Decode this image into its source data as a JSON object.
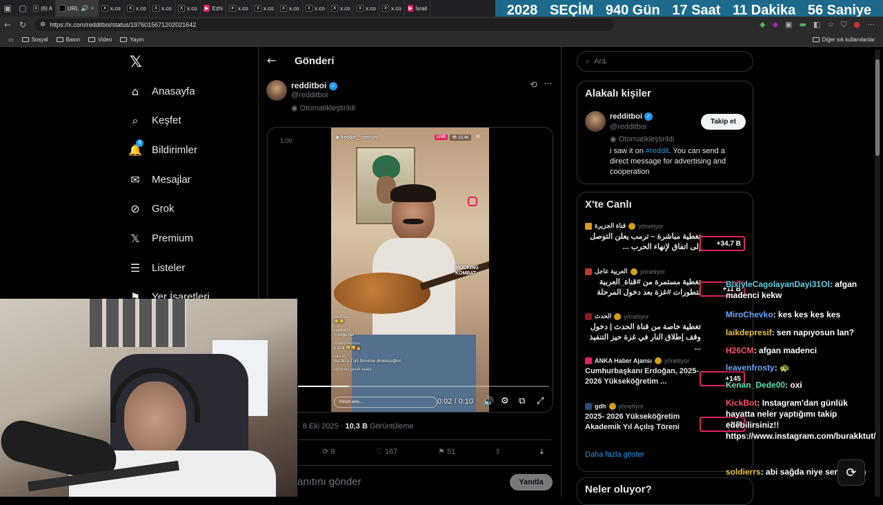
{
  "browser": {
    "tabs": [
      {
        "icon": "X",
        "label": "(6) A",
        "style": "x"
      },
      {
        "icon": "",
        "label": "URL",
        "style": "active"
      },
      {
        "icon": "X",
        "label": "x.co",
        "style": "x"
      },
      {
        "icon": "X",
        "label": "x.co",
        "style": "x"
      },
      {
        "icon": "X",
        "label": "x.co",
        "style": "x"
      },
      {
        "icon": "X",
        "label": "x.co",
        "style": "x"
      },
      {
        "icon": "▶",
        "label": "Ezhi",
        "style": "yt"
      },
      {
        "icon": "X",
        "label": "x.co",
        "style": "x"
      },
      {
        "icon": "X",
        "label": "x.co",
        "style": "x"
      },
      {
        "icon": "X",
        "label": "x.co",
        "style": "x"
      },
      {
        "icon": "X",
        "label": "x.co",
        "style": "x"
      },
      {
        "icon": "X",
        "label": "x.co",
        "style": "x"
      },
      {
        "icon": "X",
        "label": "x.co",
        "style": "x"
      },
      {
        "icon": "X",
        "label": "x.co",
        "style": "x"
      },
      {
        "icon": "▶",
        "label": "İsrail",
        "style": "yt"
      }
    ],
    "url": "https://x.com/redditboi/status/1976015671202021642",
    "bookmarks": [
      "Sosyal",
      "Basın",
      "Video",
      "Yayın"
    ],
    "other_bookmarks": "Diğer sık kullanılanlar"
  },
  "countdown": {
    "year": "2028",
    "label": "SEÇİM",
    "days": "940 Gün",
    "hours": "17 Saat",
    "minutes": "11 Dakika",
    "seconds": "56 Saniye"
  },
  "sidebar": {
    "items": [
      {
        "icon": "home-icon",
        "label": "Anasayfa"
      },
      {
        "icon": "search-icon",
        "label": "Keşfet"
      },
      {
        "icon": "bell-icon",
        "label": "Bildirimler"
      },
      {
        "icon": "mail-icon",
        "label": "Mesajlar"
      },
      {
        "icon": "grok-icon",
        "label": "Grok"
      },
      {
        "icon": "x-icon",
        "label": "Premium"
      },
      {
        "icon": "list-icon",
        "label": "Listeler"
      },
      {
        "icon": "bookmark-icon",
        "label": "Yer İşaretleri"
      }
    ],
    "notif_badge": "9"
  },
  "post": {
    "header_title": "Gönderi",
    "name": "redditboi",
    "handle": "@redditboi",
    "automated": "Otomatikleştirildi",
    "playback_speed": "1.00",
    "video": {
      "stream_user": "freddie__mercury",
      "live_badge": "LIVE",
      "viewers": "23,4K",
      "time": "0:02 / 0:10",
      "progress": 0.2,
      "watermark": "MOCKING KOMBAT",
      "comments": [
        {
          "user": "bkdf.coel",
          "text": "😂😂"
        },
        {
          "user": "jaodiano_",
          "text": "Yüreğe hel"
        },
        {
          "user": "tinanqmenusu",
          "text": "p bi ik 😂😂🔥"
        },
        {
          "user": "sau.si_",
          "text": "But $0 b Türü Bimeme dinleteceğim!"
        },
        {
          "user": "sdhmnis gerek waka",
          "text": ""
        }
      ],
      "comment_placeholder": "Yorum ekle..."
    },
    "date": "8 Eki 2025",
    "views_count": "10,3 B",
    "views_label": "Görüntüleme",
    "replies": "",
    "reposts": "9",
    "likes": "167",
    "bookmarks": "51",
    "reply_placeholder": "anıtını gönder",
    "reply_button": "Yanıtla"
  },
  "right": {
    "search_placeholder": "Ara",
    "related_title": "Alakalı kişiler",
    "related_user": {
      "name": "redditboi",
      "handle": "@redditboi",
      "automated": "Otomatikleştirildi",
      "follow": "Takip et",
      "bio_pre": "i saw it on ",
      "bio_tag": "#reddit",
      "bio_post": ". You can send a direct message for advertising and cooperation"
    },
    "live_title": "X'te Canlı",
    "live_items": [
      {
        "source": "قناة الجزيرة",
        "status": "yönetiyor",
        "title": "تغطية مباشرة – ترمب يعلن التوصل إلى اتفاق لإنهاء الحرب ...",
        "count": "+34,7 B",
        "rtl": true
      },
      {
        "source": "العربية عاجل",
        "status": "yönetiyor",
        "title": "تغطية مستمرة من #قناة_العربية لتطورات #غزة بعد دخول المرحلة",
        "count": "+11 B",
        "rtl": true
      },
      {
        "source": "الحدث",
        "status": "yönetiyor",
        "title": "تغطية خاصة من قناة الحدث | دخول وقف إطلاق النار في غزة حيز التنفيذ ...",
        "count": "",
        "rtl": true
      },
      {
        "source": "ANKA Haber Ajansı",
        "status": "yönetiyor",
        "title": "Cumhurbaşkanı Erdoğan, 2025-2026 Yükseköğretim ...",
        "count": "+145",
        "rtl": false
      },
      {
        "source": "gdh",
        "status": "yönetiyor",
        "title": "2025- 2026 Yükseköğretim Akademik Yıl Açılış Töreni",
        "count": "+1 B",
        "rtl": false
      }
    ],
    "show_more": "Daha fazla göster",
    "whats_happening": "Neler oluyor?"
  },
  "chat": [
    {
      "user": "BixiyleCagolayanDayi31Ol",
      "msg": "afgan madenci kekw",
      "color": "#5fd3e3"
    },
    {
      "user": "MiroChevko",
      "msg": "kes kes kes kes",
      "color": "#6aa8ff"
    },
    {
      "user": "laikdepresif",
      "msg": "sen napıyosun lan?",
      "color": "#e8c53a"
    },
    {
      "user": "H26CM",
      "msg": "afgan madenci",
      "color": "#ff4f6a"
    },
    {
      "user": "leavenfrosty",
      "msg": "🐢",
      "color": "#6aa8ff"
    },
    {
      "user": "Kenan_Dede00",
      "msg": "oxi",
      "color": "#5fe3b0"
    },
    {
      "user": "KickBot",
      "msg": "Instagram'dan günlük hayatta neler yaptığımı takip edebilirsiniz!! https://www.instagram.com/burakktut/",
      "color": "#ff4f6a"
    },
    {
      "user": "soldierrs",
      "msg": "abi sağda niye sen varsın",
      "color": "#e8c53a"
    }
  ],
  "colors": {
    "accent": "#1d9bf0",
    "countdown_bg": "#1e6a8c",
    "live_border": "#e0245e"
  }
}
